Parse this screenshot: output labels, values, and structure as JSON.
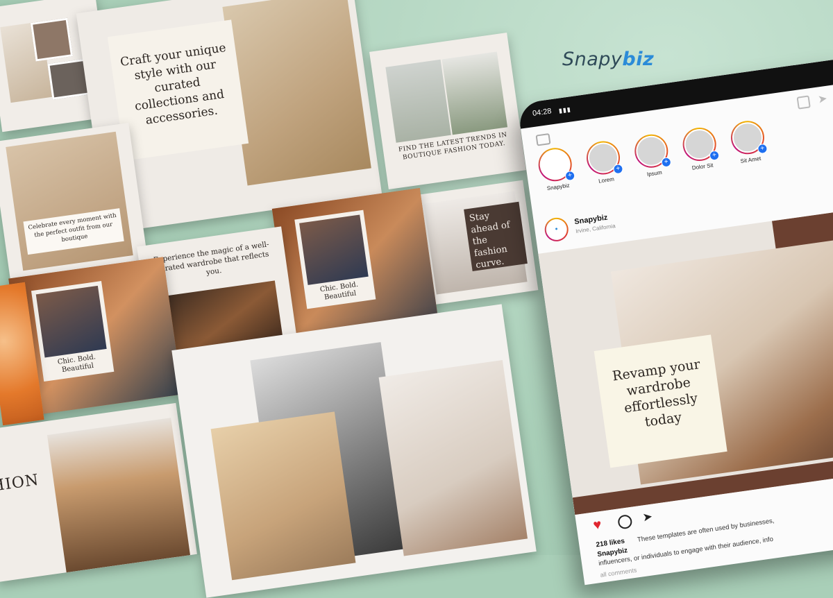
{
  "brand": {
    "name_a": "Snapy",
    "name_b": "biz"
  },
  "templates": {
    "craft_text": "Craft your unique style with our curated collections and accessories.",
    "celebrate_text": "Celebrate every moment with the perfect outfit from our boutique",
    "trends_text": "FIND THE LATEST TRENDS IN BOUTIQUE FASHION TODAY.",
    "stay_ahead_text": "Stay ahead of the fashion curve.",
    "experience_text": "Experience the magic of a well-curated wardrobe that reflects you.",
    "chic_text_1": "Chic. Bold. Beautiful",
    "chic_text_2": "Chic. Bold. Beautiful",
    "fashion_word": "HION"
  },
  "phone": {
    "status_time": "04:28",
    "stories": [
      {
        "label": "Snapybiz"
      },
      {
        "label": "Lorem"
      },
      {
        "label": "Ipsum"
      },
      {
        "label": "Dolor Sit"
      },
      {
        "label": "Sit Amet"
      }
    ],
    "post": {
      "username": "Snapybiz",
      "location": "Irvine, California",
      "headline": "Revamp your wardrobe effortlessly today",
      "likes": "218 likes",
      "caption_user": "Snapybiz",
      "caption_line1": "These templates are often used by businesses,",
      "caption_line2": "influencers, or individuals to engage with their audience, info",
      "comments": "all comments"
    }
  },
  "colors": {
    "accent": "#2b8bd8",
    "brown": "#6b4030",
    "heart": "#e0262f"
  }
}
